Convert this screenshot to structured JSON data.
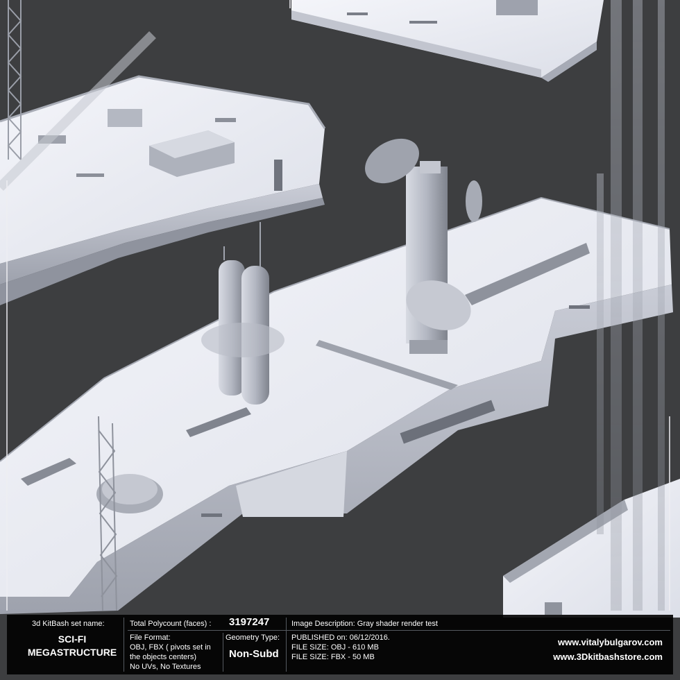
{
  "scene": {
    "description_icon": "scifi-megastructure-render",
    "colors": {
      "background": "#3d3e40",
      "hull": "#e6e8f0",
      "hull_shadow": "#8c8f98",
      "deck": "#f1f2f7"
    }
  },
  "info": {
    "set_name_label": "3d KitBash set name:",
    "set_name_line1": "SCI-FI",
    "set_name_line2": "MEGASTRUCTURE",
    "polycount_label": "Total Polycount (faces) :",
    "polycount_value": "3197247",
    "file_format_label": "File Format:",
    "file_format_line1": "OBJ, FBX ( pivots set in",
    "file_format_line2": "the objects centers)",
    "file_format_line3": "No UVs, No Textures",
    "geometry_label": "Geometry Type:",
    "geometry_value": "Non-Subd",
    "image_description": "Image Description: Gray shader render test",
    "published": "PUBLISHED on: 06/12/2016.",
    "file_size_obj": "FILE SIZE: OBJ - 610 MB",
    "file_size_fbx": "FILE SIZE: FBX - 50 MB",
    "website1": "www.vitalybulgarov.com",
    "website2": "www.3Dkitbashstore.com"
  }
}
